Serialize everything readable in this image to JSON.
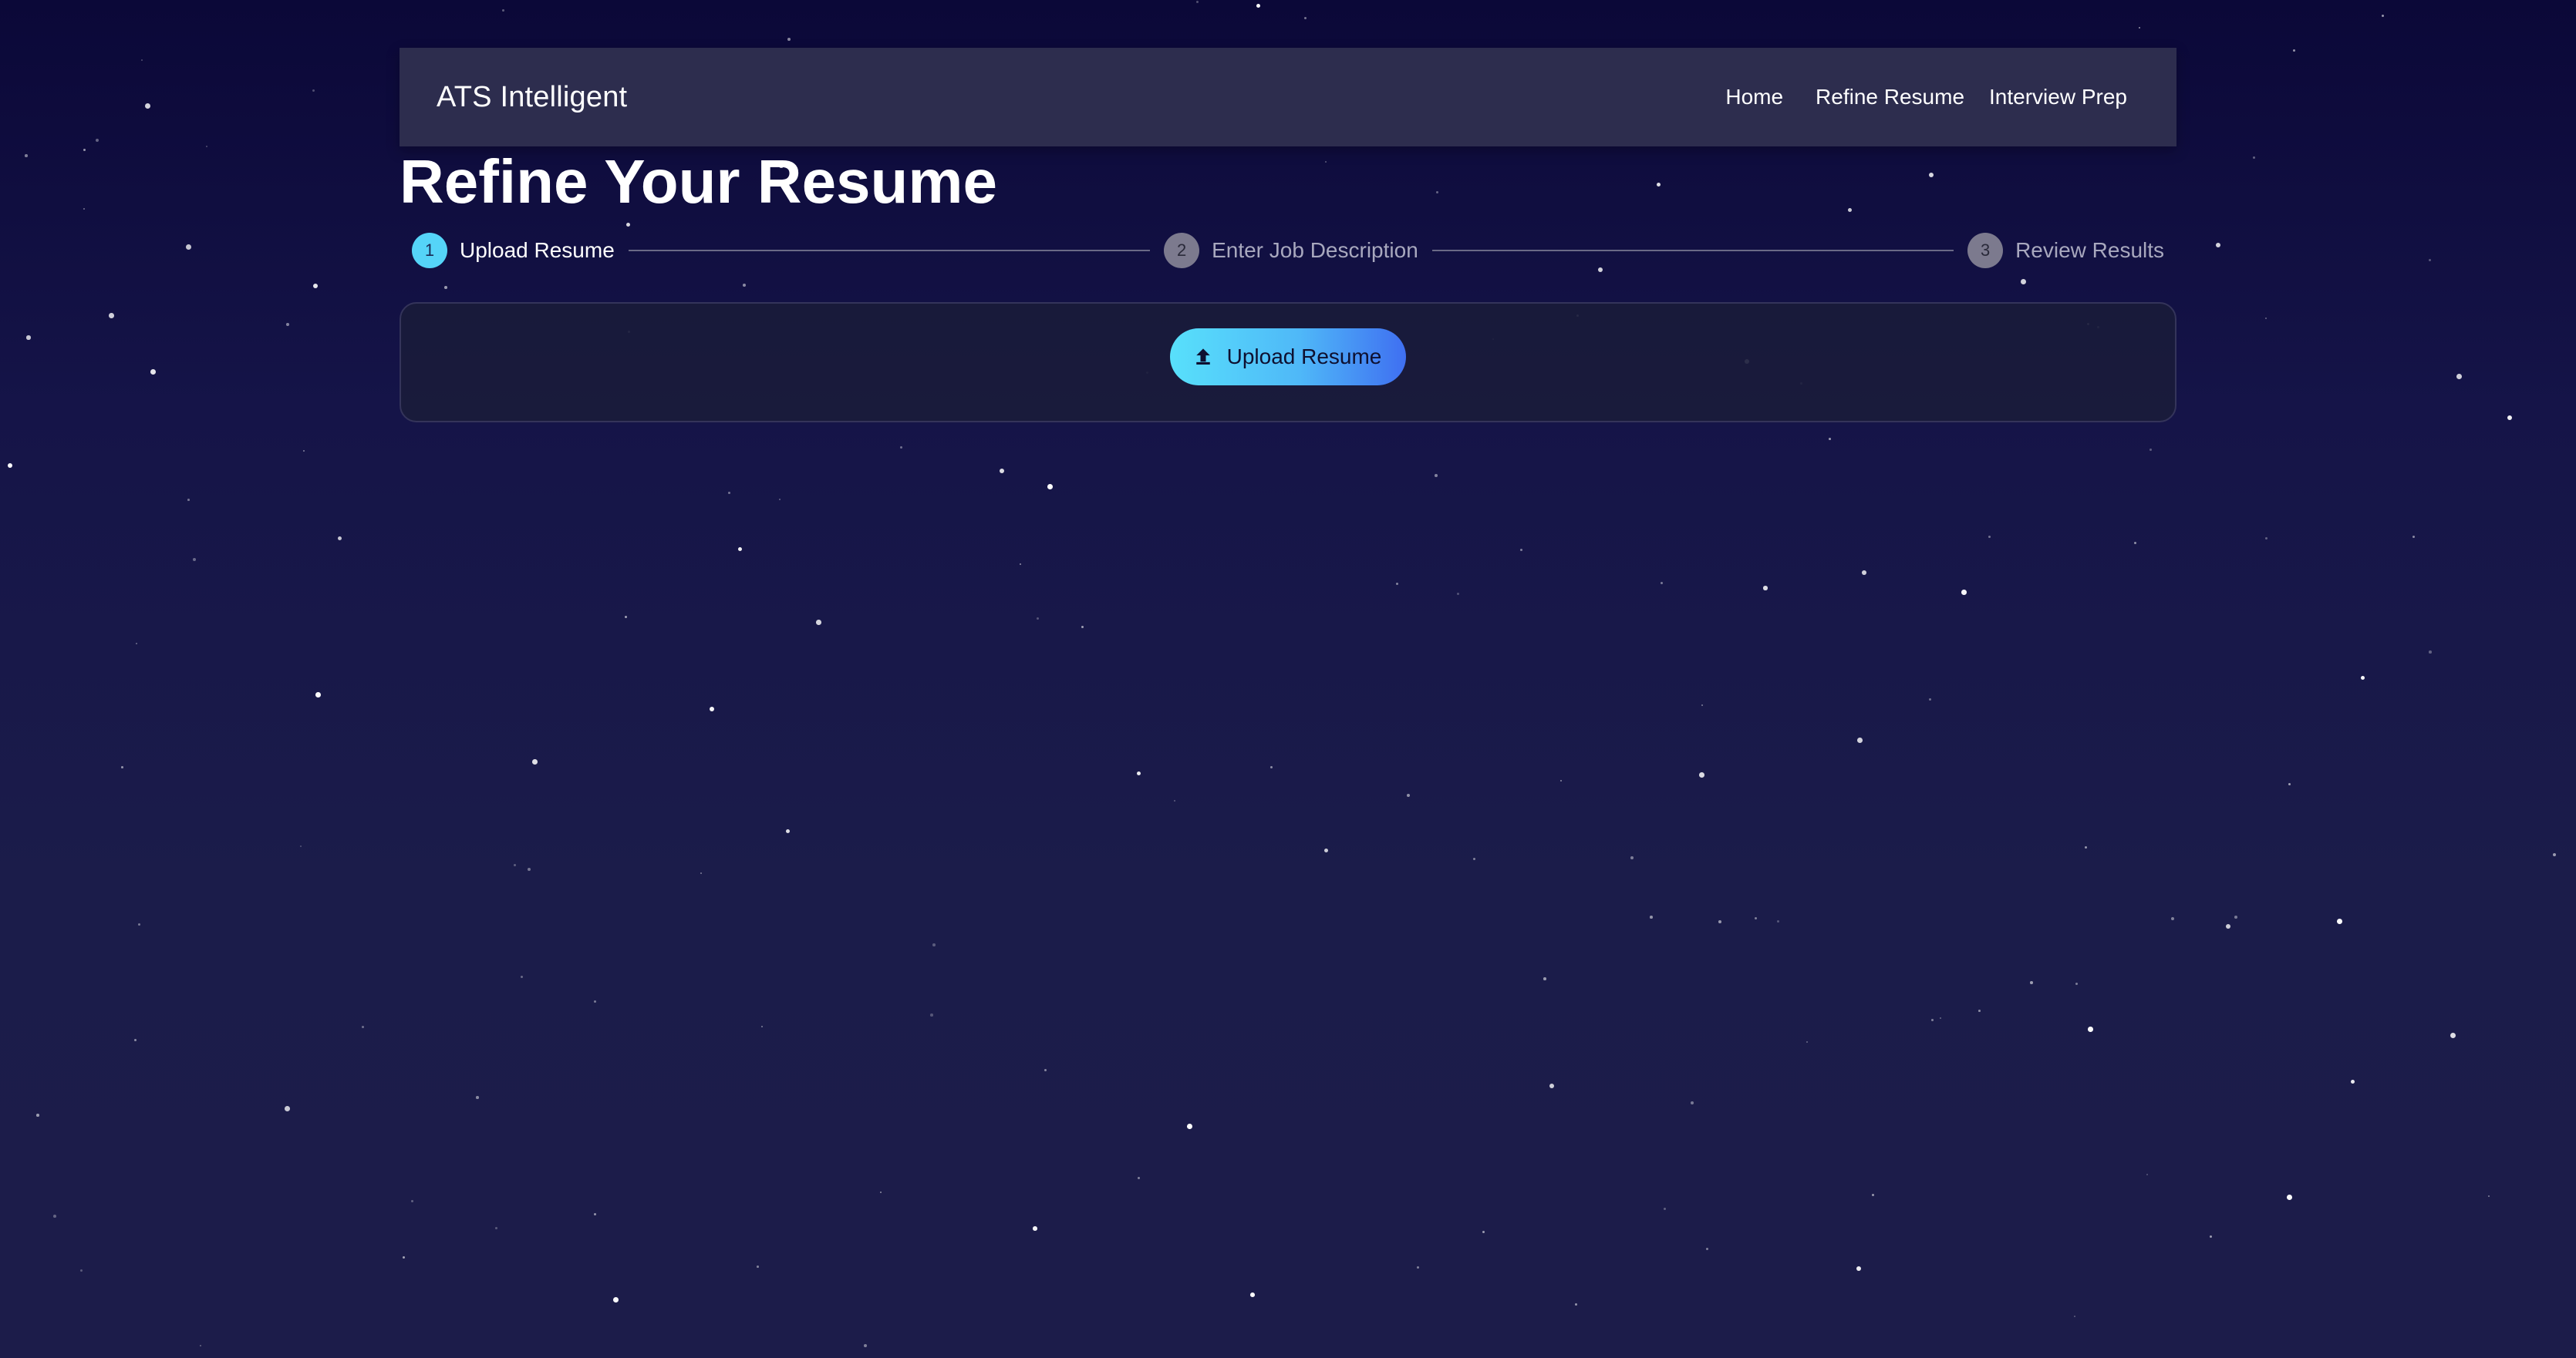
{
  "navbar": {
    "brand": "ATS Intelligent",
    "links": [
      "Home",
      "Refine Resume",
      "Interview Prep"
    ]
  },
  "page": {
    "title": "Refine Your Resume"
  },
  "stepper": {
    "steps": [
      {
        "number": "1",
        "label": "Upload Resume",
        "state": "active"
      },
      {
        "number": "2",
        "label": "Enter Job Description",
        "state": "inactive"
      },
      {
        "number": "3",
        "label": "Review Results",
        "state": "inactive"
      }
    ]
  },
  "upload": {
    "button_label": "Upload Resume",
    "icon": "upload-icon"
  },
  "colors": {
    "background_top": "#0b0838",
    "background_bottom": "#1c1c4a",
    "navbar": "#2d2d4e",
    "accent_cyan": "#55d4f8",
    "accent_blue": "#3f6ff1",
    "step_inactive": "#7c7a8e"
  }
}
